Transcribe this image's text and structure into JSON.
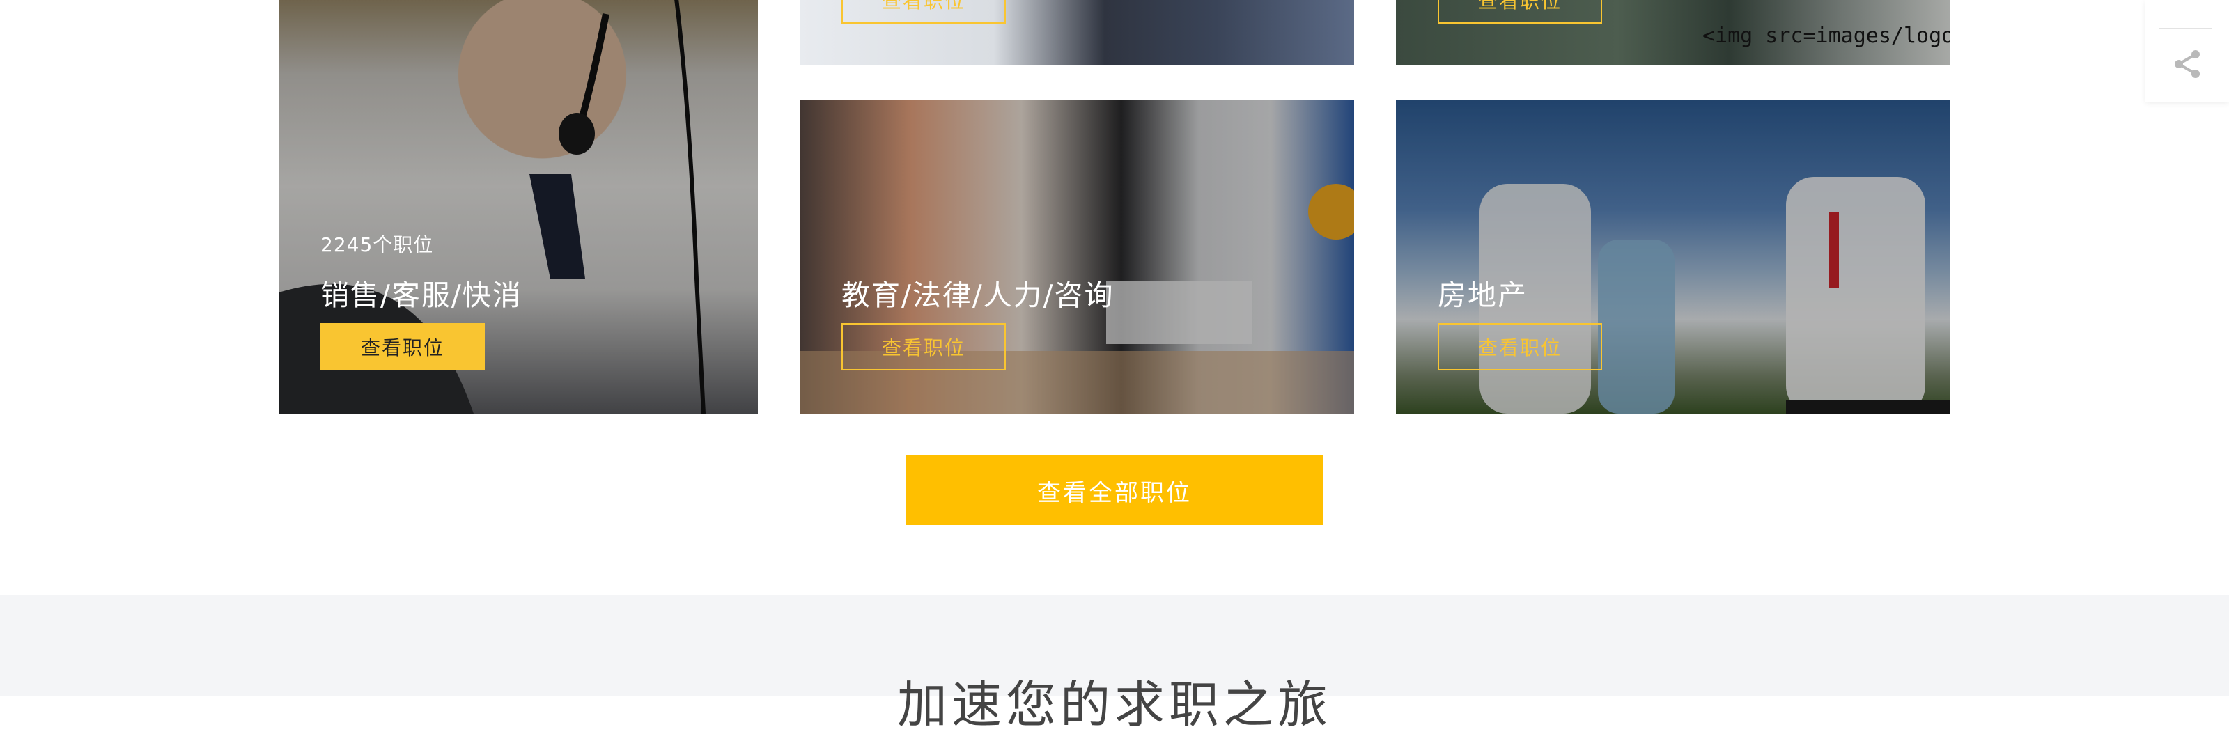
{
  "cards": {
    "sales": {
      "count": "2245个职位",
      "title": "销售/客服/快消",
      "button": "查看职位"
    },
    "top_mid": {
      "button": "查看职位"
    },
    "top_right": {
      "button": "查看职位",
      "overlay_text": "<img src=images/logo.pn"
    },
    "education": {
      "title": "教育/法律/人力/咨询",
      "button": "查看职位"
    },
    "real_estate": {
      "title": "房地产",
      "button": "查看职位"
    }
  },
  "view_all_label": "查看全部职位",
  "section_heading": "加速您的求职之旅",
  "share": {
    "icon": "share-icon"
  },
  "colors": {
    "accent": "#ffbf00",
    "button_yellow": "#f9c531",
    "section_bg": "#f4f5f7"
  }
}
